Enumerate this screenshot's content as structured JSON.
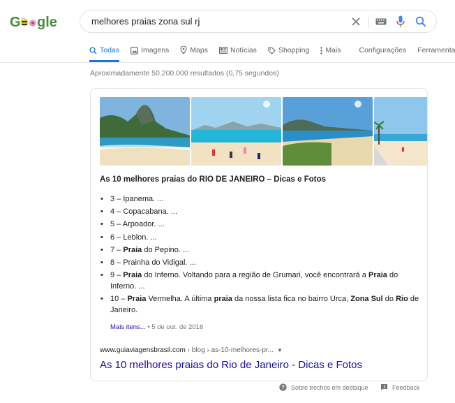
{
  "search": {
    "query": "melhores praias zona sul rj"
  },
  "tabs": [
    {
      "label": "Todas",
      "icon": "search-icon",
      "active": true
    },
    {
      "label": "Imagens",
      "icon": "image-icon"
    },
    {
      "label": "Maps",
      "icon": "map-pin-icon"
    },
    {
      "label": "Notícias",
      "icon": "news-icon"
    },
    {
      "label": "Shopping",
      "icon": "tag-icon"
    },
    {
      "label": "Mais",
      "icon": "more-vert-icon"
    },
    {
      "label": "Configurações"
    },
    {
      "label": "Ferramentas"
    }
  ],
  "stats": "Aproximadamente 50.200.000 resultados (0,75 segundos)",
  "snippet": {
    "title": "As 10 melhores praias do RIO DE JANEIRO – Dicas e Fotos",
    "items": [
      {
        "parts": [
          [
            "3 – Ipanema. ...",
            false
          ]
        ]
      },
      {
        "parts": [
          [
            "4 – Copacabana. ...",
            false
          ]
        ]
      },
      {
        "parts": [
          [
            "5 – Arpoador. ...",
            false
          ]
        ]
      },
      {
        "parts": [
          [
            "6 – Leblon. ...",
            false
          ]
        ]
      },
      {
        "parts": [
          [
            "7 – ",
            false
          ],
          [
            "Praia",
            true
          ],
          [
            " do Pepino. ...",
            false
          ]
        ]
      },
      {
        "parts": [
          [
            "8 – Prainha do Vidigal. ...",
            false
          ]
        ]
      },
      {
        "parts": [
          [
            "9 – ",
            false
          ],
          [
            "Praia",
            true
          ],
          [
            " do Inferno. Voltando para a região de Grumari, você encontrará a ",
            false
          ],
          [
            "Praia",
            true
          ],
          [
            " do Inferno. ...",
            false
          ]
        ]
      },
      {
        "parts": [
          [
            "10 – ",
            false
          ],
          [
            "Praia",
            true
          ],
          [
            " Vermelha. A última ",
            false
          ],
          [
            "praia",
            true
          ],
          [
            " da nossa lista fica no bairro Urca, ",
            false
          ],
          [
            "Zona Sul",
            true
          ],
          [
            " do ",
            false
          ],
          [
            "Rio",
            true
          ],
          [
            " de Janeiro.",
            false
          ]
        ]
      }
    ],
    "more_label": "Mais itens...",
    "date": "5 de out. de 2016",
    "cite_domain": "www.guiaviagensbrasil.com",
    "cite_path": " › blog › as-10-melhores-pr...",
    "result_title": "As 10 melhores praias do Rio de Janeiro - Dicas e Fotos"
  },
  "footer": {
    "about": "Sobre trechos em destaque",
    "feedback": "Feedback"
  },
  "colors": {
    "link": "#1a0dab",
    "accent": "#1a73e8",
    "muted": "#70757a"
  }
}
